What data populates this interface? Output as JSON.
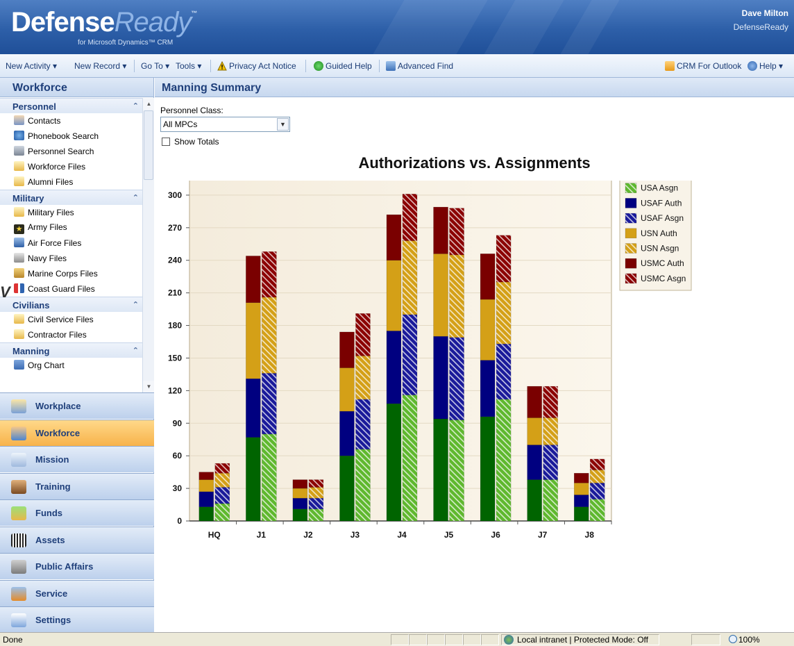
{
  "app": {
    "logo_main": "Defense",
    "logo_accent": "Ready",
    "logo_tm": "™",
    "logo_sub": "for Microsoft Dynamics™ CRM",
    "user_name": "Dave Milton",
    "user_org": "DefenseReady"
  },
  "menubar": {
    "new_activity": "New Activity ▾",
    "new_record": "New Record ▾",
    "go_to": "Go To ▾",
    "tools": "Tools ▾",
    "privacy": "Privacy Act Notice",
    "guided_help": "Guided Help",
    "advanced_find": "Advanced Find",
    "crm_outlook": "CRM For Outlook",
    "help": "Help ▾"
  },
  "leftnav": {
    "title": "Workforce",
    "groups": [
      {
        "label": "Personnel",
        "items": [
          {
            "label": "Contacts",
            "icon": "contacts-icon"
          },
          {
            "label": "Phonebook Search",
            "icon": "phonebook-icon"
          },
          {
            "label": "Personnel Search",
            "icon": "personnel-search-icon"
          },
          {
            "label": "Workforce Files",
            "icon": "folder-icon"
          },
          {
            "label": "Alumni Files",
            "icon": "folder-icon"
          }
        ]
      },
      {
        "label": "Military",
        "items": [
          {
            "label": "Military Files",
            "icon": "folder-icon"
          },
          {
            "label": "Army Files",
            "icon": "army-star-icon"
          },
          {
            "label": "Air Force Files",
            "icon": "air-force-icon"
          },
          {
            "label": "Navy Files",
            "icon": "navy-icon"
          },
          {
            "label": "Marine Corps Files",
            "icon": "marine-corps-icon"
          },
          {
            "label": "Coast Guard Files",
            "icon": "coast-guard-icon"
          }
        ]
      },
      {
        "label": "Civilians",
        "items": [
          {
            "label": "Civil Service Files",
            "icon": "folder-icon"
          },
          {
            "label": "Contractor Files",
            "icon": "folder-icon"
          }
        ]
      },
      {
        "label": "Manning",
        "items": [
          {
            "label": "Org Chart",
            "icon": "org-chart-icon"
          }
        ]
      }
    ],
    "wunderbar": [
      {
        "label": "Workplace",
        "icon": "workplace-icon",
        "active": false
      },
      {
        "label": "Workforce",
        "icon": "workforce-icon",
        "active": true
      },
      {
        "label": "Mission",
        "icon": "mission-icon",
        "active": false
      },
      {
        "label": "Training",
        "icon": "training-icon",
        "active": false
      },
      {
        "label": "Funds",
        "icon": "funds-icon",
        "active": false
      },
      {
        "label": "Assets",
        "icon": "assets-icon",
        "active": false
      },
      {
        "label": "Public Affairs",
        "icon": "public-affairs-icon",
        "active": false
      },
      {
        "label": "Service",
        "icon": "service-icon",
        "active": false
      },
      {
        "label": "Settings",
        "icon": "settings-icon",
        "active": false
      }
    ]
  },
  "main": {
    "title": "Manning Summary",
    "personnel_class_label": "Personnel Class:",
    "personnel_class_value": "All MPCs",
    "show_totals_label": "Show Totals",
    "stray_glyph": "V"
  },
  "chart_data": {
    "type": "bar",
    "stacked": true,
    "title": "Authorizations vs. Assignments",
    "categories": [
      "HQ",
      "J1",
      "J2",
      "J3",
      "J4",
      "J5",
      "J6",
      "J7",
      "J8"
    ],
    "ylim": [
      0,
      330
    ],
    "yticks": [
      0,
      30,
      60,
      90,
      120,
      150,
      180,
      210,
      240,
      270,
      300,
      330
    ],
    "grid": true,
    "legend_position": "right",
    "stack_groups": [
      "Auth",
      "Asgn"
    ],
    "series": [
      {
        "name": "USA Auth",
        "group": "Auth",
        "color": "#006400",
        "pattern": false,
        "values": [
          13,
          77,
          11,
          60,
          108,
          94,
          96,
          38,
          13
        ]
      },
      {
        "name": "USA Asgn",
        "group": "Asgn",
        "color": "#5fb82e",
        "pattern": true,
        "values": [
          16,
          80,
          11,
          66,
          116,
          93,
          112,
          38,
          20
        ]
      },
      {
        "name": "USAF Auth",
        "group": "Auth",
        "color": "#000080",
        "pattern": false,
        "values": [
          14,
          54,
          10,
          41,
          67,
          76,
          52,
          32,
          11
        ]
      },
      {
        "name": "USAF Asgn",
        "group": "Asgn",
        "color": "#1a1a9a",
        "pattern": true,
        "values": [
          15,
          56,
          10,
          46,
          74,
          76,
          51,
          32,
          15
        ]
      },
      {
        "name": "USN Auth",
        "group": "Auth",
        "color": "#d4a017",
        "pattern": false,
        "values": [
          11,
          70,
          9,
          40,
          65,
          76,
          56,
          25,
          11
        ]
      },
      {
        "name": "USN Asgn",
        "group": "Asgn",
        "color": "#d4a017",
        "pattern": true,
        "values": [
          13,
          70,
          10,
          40,
          68,
          76,
          57,
          25,
          12
        ]
      },
      {
        "name": "USMC Auth",
        "group": "Auth",
        "color": "#7a0000",
        "pattern": false,
        "values": [
          7,
          43,
          8,
          33,
          42,
          43,
          42,
          29,
          9
        ]
      },
      {
        "name": "USMC Asgn",
        "group": "Asgn",
        "color": "#8b0000",
        "pattern": true,
        "values": [
          9,
          42,
          7,
          39,
          43,
          43,
          43,
          29,
          10
        ]
      }
    ]
  },
  "statusbar": {
    "status": "Done",
    "zone": "Local intranet | Protected Mode: Off",
    "zoom": "100%"
  }
}
